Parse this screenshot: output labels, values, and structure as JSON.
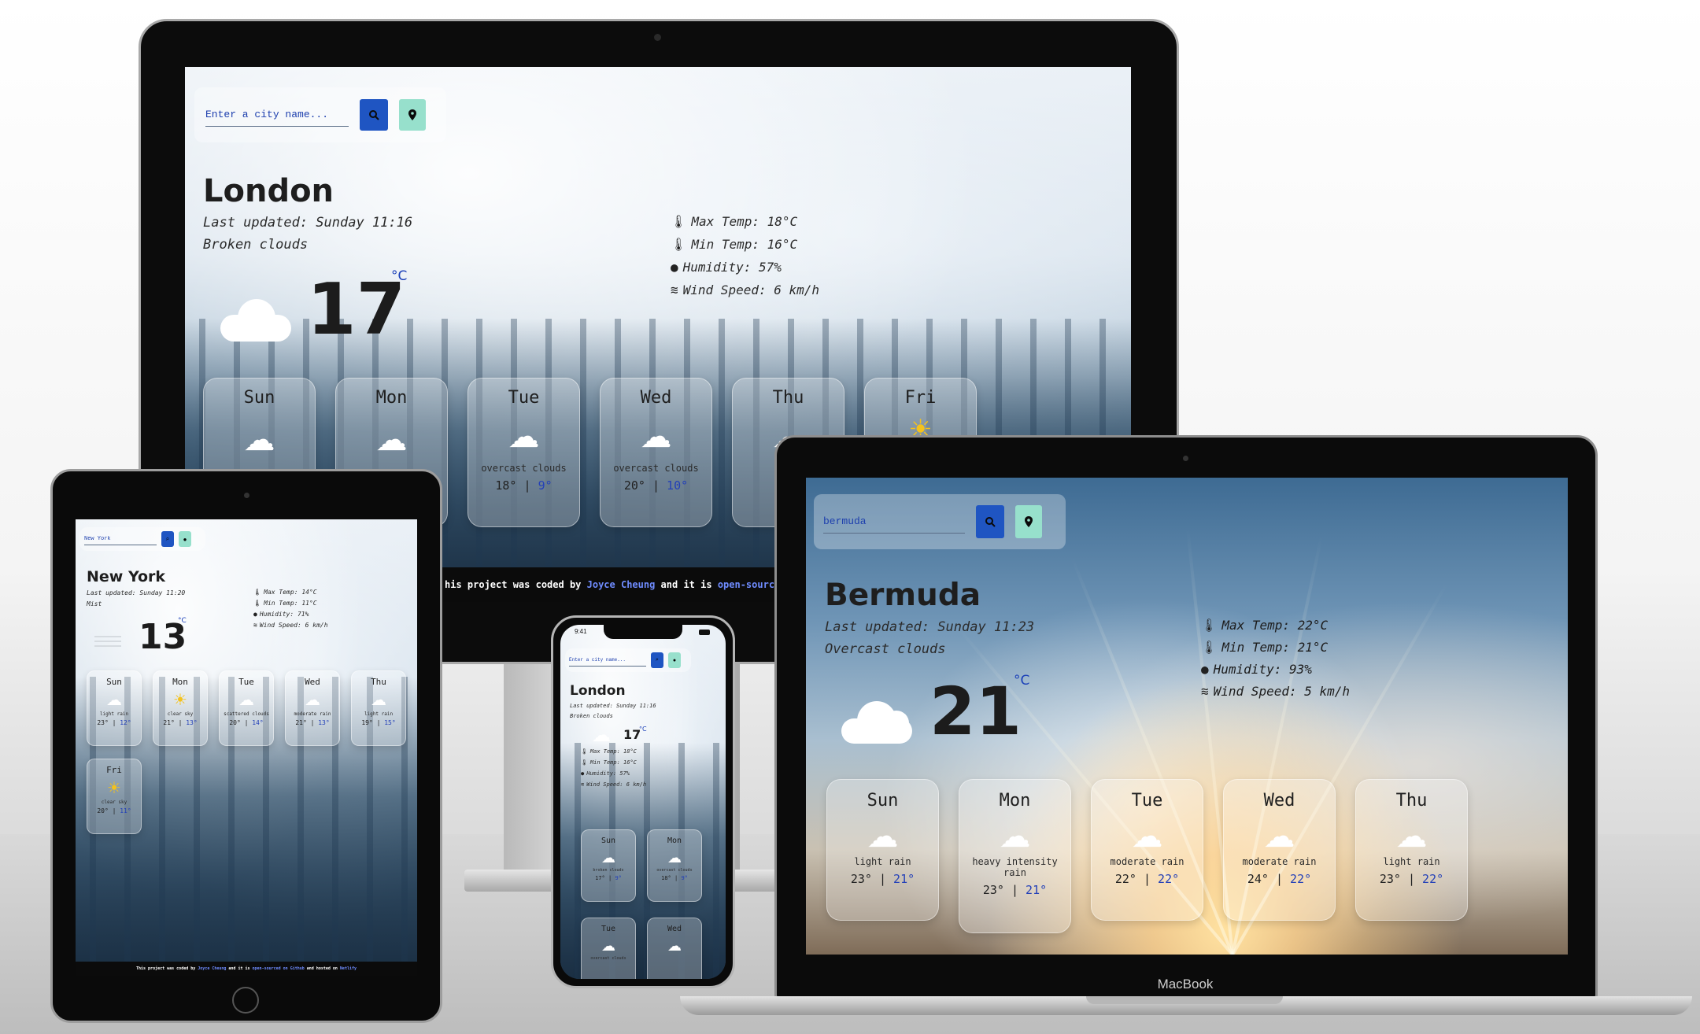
{
  "colors": {
    "accent": "#1f55c2",
    "location": "#97e0cc",
    "unit": "#1a3fb8"
  },
  "brand": "MacBook",
  "imac": {
    "placeholder": "Enter a city name...",
    "city": "London",
    "updated": "Last updated: Sunday 11:16",
    "condition": "Broken clouds",
    "temp": "17",
    "unit": "°C",
    "stats": [
      "Max Temp: 18°C",
      "Min Temp: 16°C",
      "Humidity: 57%",
      "Wind Speed: 6 km/h"
    ],
    "forecast": [
      {
        "day": "Sun",
        "desc": "",
        "hi": "",
        "lo": ""
      },
      {
        "day": "Mon",
        "desc": "",
        "hi": "",
        "lo": ""
      },
      {
        "day": "Tue",
        "desc": "overcast clouds",
        "hi": "18°",
        "lo": "9°"
      },
      {
        "day": "Wed",
        "desc": "overcast clouds",
        "hi": "20°",
        "lo": "10°"
      },
      {
        "day": "Thu",
        "desc": "bro",
        "hi": "2",
        "lo": ""
      },
      {
        "day": "Fri",
        "desc": "",
        "hi": "",
        "lo": ""
      }
    ],
    "footer": {
      "pre": "his project was coded by ",
      "author": "Joyce Cheung",
      "mid": " and it is ",
      "link": "open-sourced on Githu"
    }
  },
  "ipad": {
    "search_value": "New York",
    "city": "New York",
    "updated": "Last updated: Sunday 11:20",
    "condition": "Mist",
    "temp": "13",
    "unit": "°C",
    "stats": [
      "Max Temp: 14°C",
      "Min Temp: 11°C",
      "Humidity: 71%",
      "Wind Speed: 6 km/h"
    ],
    "forecast": [
      {
        "day": "Sun",
        "desc": "light rain",
        "hi": "23°",
        "lo": "12°"
      },
      {
        "day": "Mon",
        "desc": "clear sky",
        "hi": "21°",
        "lo": "13°"
      },
      {
        "day": "Tue",
        "desc": "scattered clouds",
        "hi": "20°",
        "lo": "14°"
      },
      {
        "day": "Wed",
        "desc": "moderate rain",
        "hi": "21°",
        "lo": "13°"
      },
      {
        "day": "Thu",
        "desc": "light rain",
        "hi": "19°",
        "lo": "15°"
      },
      {
        "day": "Fri",
        "desc": "clear sky",
        "hi": "20°",
        "lo": "11°"
      }
    ],
    "footer": {
      "pre": "This project was coded by ",
      "author": "Joyce Cheung",
      "mid": " and it is ",
      "link": "open-sourced on Github",
      "post": " and hosted on ",
      "host": "Netlify"
    }
  },
  "iphone": {
    "time": "9:41",
    "placeholder": "Enter a city name...",
    "city": "London",
    "updated": "Last updated: Sunday 11:16",
    "condition": "Broken clouds",
    "temp": "17",
    "unit": "°C",
    "stats": [
      "Max Temp: 18°C",
      "Min Temp: 16°C",
      "Humidity: 57%",
      "Wind Speed: 6 km/h"
    ],
    "forecast": [
      {
        "day": "Sun",
        "desc": "broken clouds",
        "hi": "17°",
        "lo": "9°"
      },
      {
        "day": "Mon",
        "desc": "overcast clouds",
        "hi": "18°",
        "lo": "9°"
      },
      {
        "day": "Tue",
        "desc": "overcast clouds",
        "hi": "",
        "lo": ""
      },
      {
        "day": "Wed",
        "desc": "",
        "hi": "",
        "lo": ""
      }
    ]
  },
  "macbook": {
    "search_value": "bermuda",
    "city": "Bermuda",
    "updated": "Last updated: Sunday 11:23",
    "condition": "Overcast clouds",
    "temp": "21",
    "unit": "°C",
    "stats": [
      "Max Temp: 22°C",
      "Min Temp: 21°C",
      "Humidity: 93%",
      "Wind Speed: 5 km/h"
    ],
    "forecast": [
      {
        "day": "Sun",
        "desc": "light rain",
        "hi": "23°",
        "lo": "21°"
      },
      {
        "day": "Mon",
        "desc": "heavy intensity rain",
        "hi": "23°",
        "lo": "21°"
      },
      {
        "day": "Tue",
        "desc": "moderate rain",
        "hi": "22°",
        "lo": "22°"
      },
      {
        "day": "Wed",
        "desc": "moderate rain",
        "hi": "24°",
        "lo": "22°"
      },
      {
        "day": "Thu",
        "desc": "light rain",
        "hi": "23°",
        "lo": "22°"
      }
    ]
  }
}
